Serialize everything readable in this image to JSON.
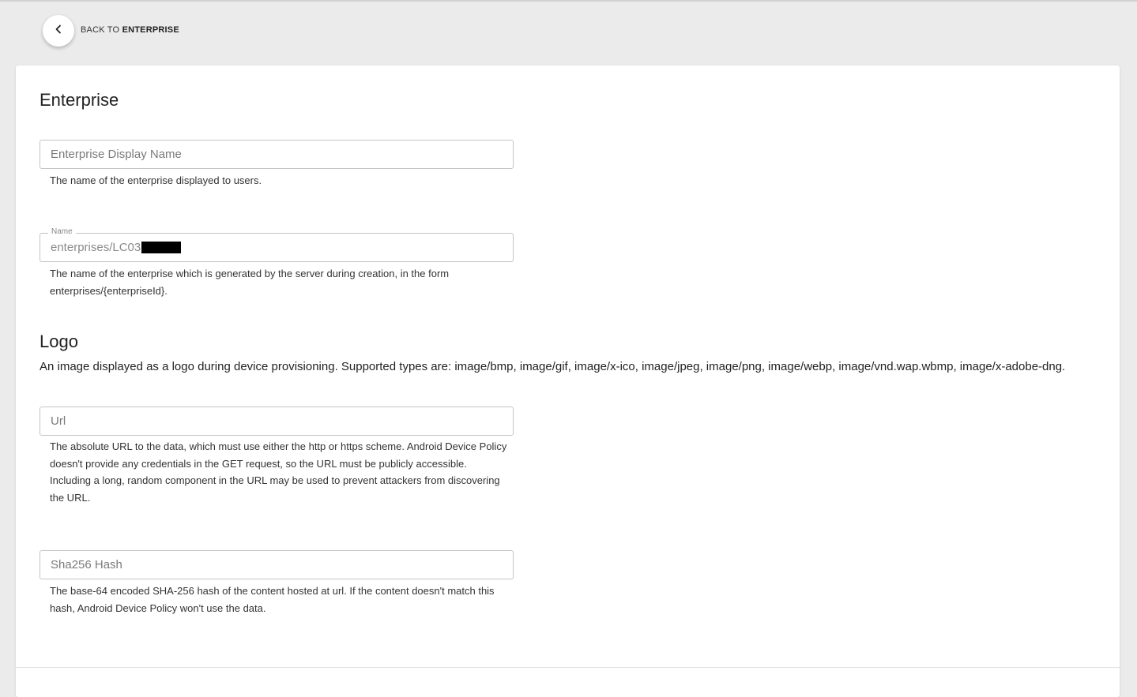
{
  "nav": {
    "back_prefix": "BACK TO",
    "back_target": "ENTERPRISE"
  },
  "enterprise_section": {
    "title": "Enterprise",
    "display_name": {
      "placeholder": "Enterprise Display Name",
      "value": "",
      "helper": "The name of the enterprise displayed to users."
    },
    "name": {
      "label": "Name",
      "value": "enterprises/LC03",
      "helper": "The name of the enterprise which is generated by the server during creation, in the form enterprises/{enterpriseId}."
    }
  },
  "logo_section": {
    "title": "Logo",
    "description": "An image displayed as a logo during device provisioning. Supported types are: image/bmp, image/gif, image/x-ico, image/jpeg, image/png, image/webp, image/vnd.wap.wbmp, image/x-adobe-dng.",
    "url": {
      "placeholder": "Url",
      "value": "",
      "helper": "The absolute URL to the data, which must use either the http or https scheme. Android Device Policy doesn't provide any credentials in the GET request, so the URL must be publicly accessible. Including a long, random component in the URL may be used to prevent attackers from discovering the URL."
    },
    "sha256": {
      "placeholder": "Sha256 Hash",
      "value": "",
      "helper": "The base-64 encoded SHA-256 hash of the content hosted at url. If the content doesn't match this hash, Android Device Policy won't use the data."
    }
  },
  "icons": {
    "back": "chevron-left-icon"
  }
}
